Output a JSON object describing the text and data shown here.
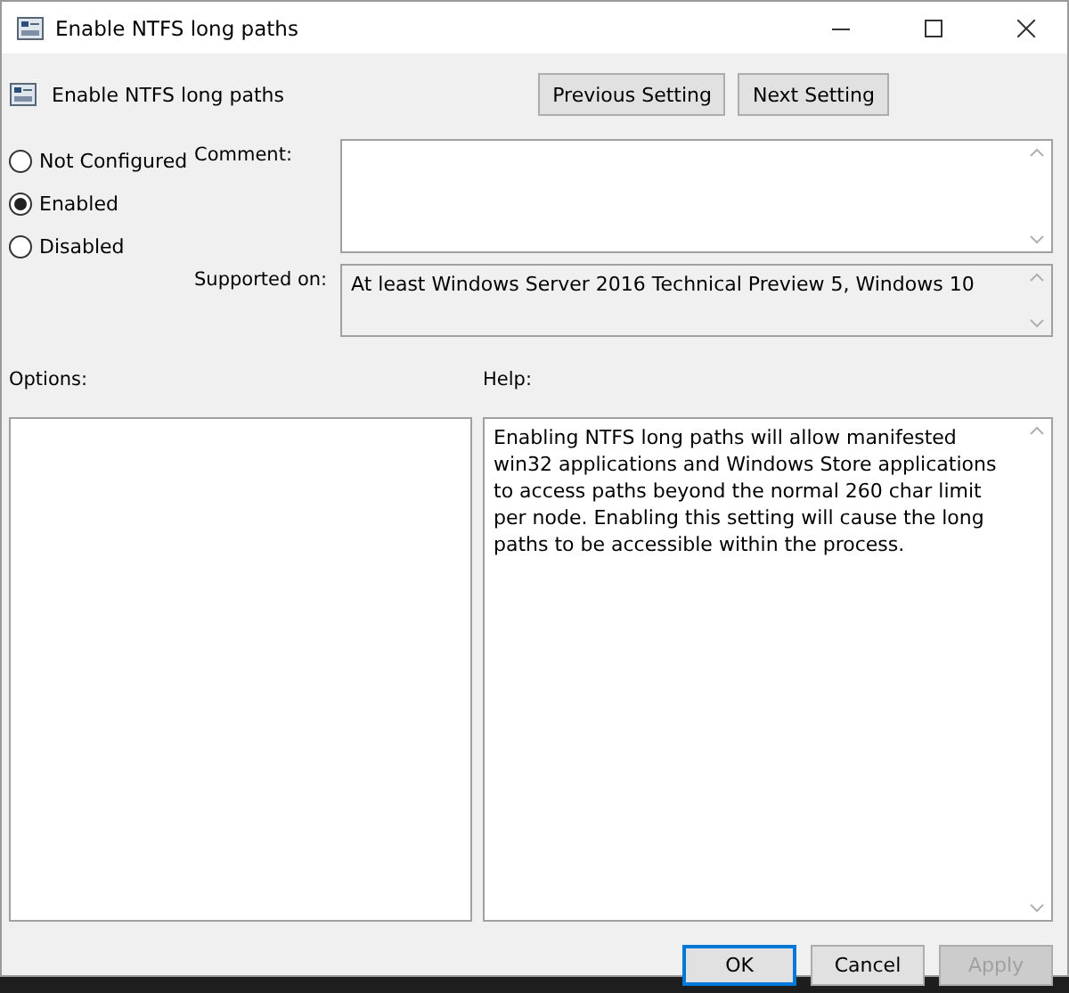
{
  "window": {
    "title": "Enable NTFS long paths"
  },
  "header": {
    "title": "Enable NTFS long paths"
  },
  "nav_buttons": [
    {
      "label": "Previous Setting"
    },
    {
      "label": "Next Setting"
    }
  ],
  "state_options": [
    {
      "label": "Not Configured",
      "selected": false
    },
    {
      "label": "Enabled",
      "selected": true
    },
    {
      "label": "Disabled",
      "selected": false
    }
  ],
  "comment": {
    "label": "Comment:"
  },
  "supported_on": {
    "label": "Supported on:",
    "value": "At least Windows Server 2016 Technical Preview 5, Windows 10"
  },
  "options": {
    "label": "Options:"
  },
  "help": {
    "label": "Help:",
    "text": "Enabling NTFS long paths will allow manifested win32 applications and Windows Store applications to access paths beyond the normal 260 char limit per node.  Enabling this setting will cause the long paths to be accessible within the process."
  },
  "buttons": [
    {
      "label": "OK",
      "disabled": false,
      "default": true
    },
    {
      "label": "Cancel",
      "disabled": false,
      "default": false
    },
    {
      "label": "Apply",
      "disabled": true,
      "default": false
    }
  ]
}
